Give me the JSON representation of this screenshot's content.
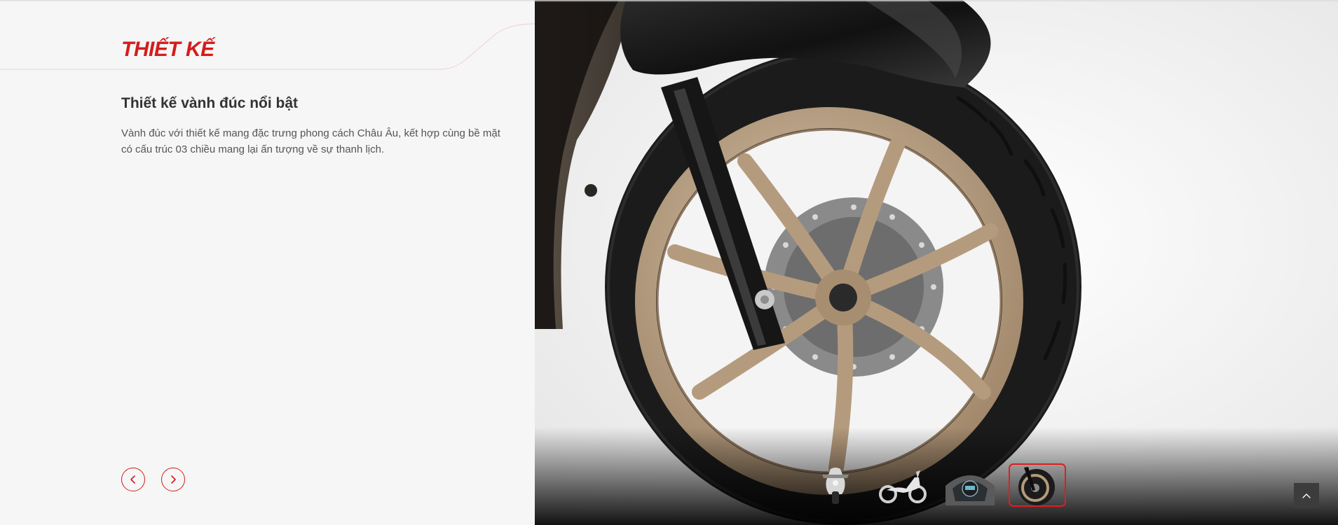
{
  "section": {
    "title": "THIẾT KẾ"
  },
  "feature": {
    "title": "Thiết kế vành đúc nổi bật",
    "description": "Vành đúc với thiết kế mang đặc trưng phong cách Châu Âu, kết hợp cùng bề mặt có cấu trúc 03 chiều mang lại ấn tượng về sự thanh lịch."
  },
  "navigation": {
    "prev_icon": "chevron-left-icon",
    "next_icon": "chevron-right-icon"
  },
  "gallery": {
    "main_image": "scooter-front-wheel-cast-rim",
    "active_index": 3,
    "thumbnails": [
      {
        "subject": "scooter-front-view"
      },
      {
        "subject": "scooter-side-view"
      },
      {
        "subject": "scooter-dashboard"
      },
      {
        "subject": "scooter-front-wheel"
      }
    ]
  },
  "back_to_top": {
    "icon": "chevron-up-icon"
  },
  "colors": {
    "accent": "#d41c1c",
    "title_text": "#333333",
    "body_text": "#555555",
    "background": "#f6f6f6",
    "rim_bronze": "#b49a7c",
    "tire": "#1b1b1b"
  }
}
